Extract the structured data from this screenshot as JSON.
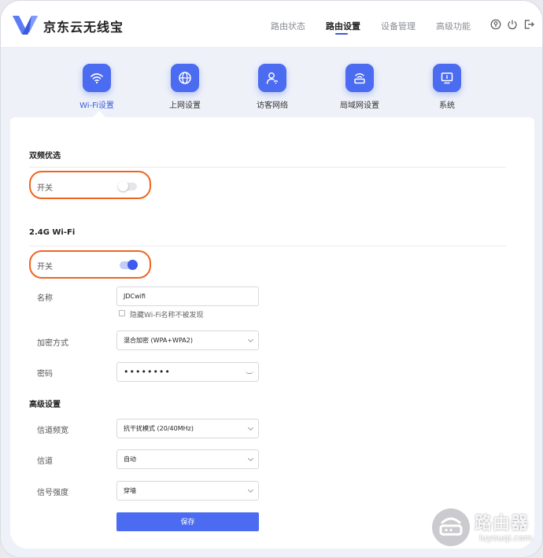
{
  "header": {
    "brand": "京东云无线宝",
    "nav": [
      {
        "label": "路由状态"
      },
      {
        "label": "路由设置"
      },
      {
        "label": "设备管理"
      },
      {
        "label": "高级功能"
      }
    ],
    "active_nav": "路由设置"
  },
  "categories": [
    {
      "label": "Wi-Fi设置",
      "icon": "wifi-icon"
    },
    {
      "label": "上网设置",
      "icon": "globe-icon"
    },
    {
      "label": "访客网络",
      "icon": "guest-icon"
    },
    {
      "label": "局域网设置",
      "icon": "router-icon"
    },
    {
      "label": "系统",
      "icon": "monitor-icon"
    }
  ],
  "active_category": "Wi-Fi设置",
  "dual_band": {
    "title": "双频优选",
    "switch_label": "开关",
    "switch_on": false
  },
  "wifi24": {
    "title": "2.4G Wi-Fi",
    "switch_label": "开关",
    "switch_on": true,
    "name_label": "名称",
    "name_value": "JDCwifi",
    "hide_label": "隐藏Wi-Fi名称不被发现",
    "encryption_label": "加密方式",
    "encryption_value": "混合加密 (WPA+WPA2)",
    "password_label": "密码",
    "password_value": "••••••••"
  },
  "advanced": {
    "title": "高级设置",
    "bandwidth_label": "信道频宽",
    "bandwidth_value": "抗干扰模式 (20/40MHz)",
    "channel_label": "信道",
    "channel_value": "自动",
    "strength_label": "信号强度",
    "strength_value": "穿墙",
    "save_label": "保存"
  },
  "watermark": {
    "text": "路由器",
    "url": "luyouqi.com"
  },
  "colors": {
    "accent": "#4b6bf0",
    "highlight_ring": "#f0641f"
  }
}
